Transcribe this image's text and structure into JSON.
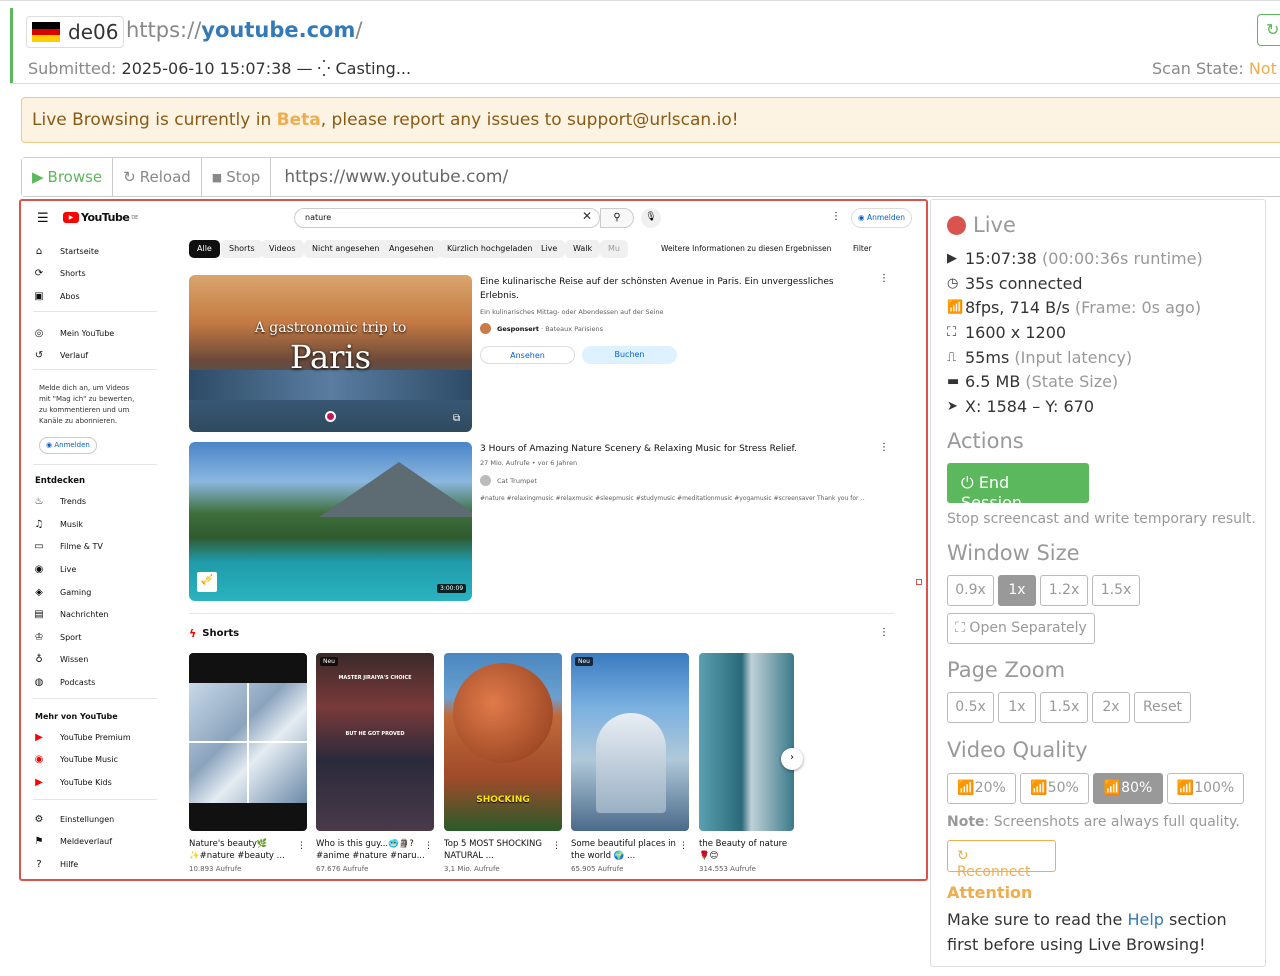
{
  "header": {
    "tag": "de06",
    "url_prefix": "https://",
    "url_domain": "youtube.com",
    "url_suffix": "/",
    "submitted_label": "Submitted:",
    "submitted_value": "2025-06-10 15:07:38",
    "status_sep": "—",
    "status": "Casting...",
    "scan_label": "Scan State:",
    "scan_value": "Not s"
  },
  "beta": {
    "pre": "Live Browsing is currently in ",
    "highlight": "Beta",
    "post": ", please report any issues to support@urlscan.io!"
  },
  "toolbar": {
    "browse": "Browse",
    "reload": "Reload",
    "stop": "Stop",
    "address": "https://www.youtube.com/"
  },
  "yt": {
    "logo": "YouTube",
    "logo_sup": "DE",
    "search_value": "nature",
    "signin": "Anmelden",
    "sidebar": {
      "home": "Startseite",
      "shorts": "Shorts",
      "subs": "Abos",
      "you": "Mein YouTube",
      "history": "Verlauf",
      "prompt": "Melde dich an, um Videos mit \"Mag ich\" zu bewerten, zu kommentieren und um Kanäle zu abonnieren.",
      "signin": "Anmelden",
      "explore_title": "Entdecken",
      "trends": "Trends",
      "music": "Musik",
      "movies": "Filme & TV",
      "live": "Live",
      "gaming": "Gaming",
      "news": "Nachrichten",
      "sport": "Sport",
      "learn": "Wissen",
      "podcasts": "Podcasts",
      "more_title": "Mehr von YouTube",
      "premium": "YouTube Premium",
      "ytmusic": "YouTube Music",
      "kids": "YouTube Kids",
      "settings": "Einstellungen",
      "report": "Meldeverlauf",
      "help": "Hilfe"
    },
    "chips": [
      "Alle",
      "Shorts",
      "Videos",
      "Nicht angesehen",
      "Angesehen",
      "Kürzlich hochgeladen",
      "Live",
      "Walk",
      "Mu"
    ],
    "more_info": "Weitere Informationen zu diesen Ergebnissen",
    "filter": "Filter",
    "ad": {
      "title": "Eine kulinarische Reise auf der schönsten Avenue in Paris. Ein unvergessliches Erlebnis.",
      "desc": "Ein kulinarisches Mittag- oder Abendessen auf der Seine",
      "sponsored": "Gesponsert",
      "sep": "·",
      "advertiser": "Bateaux Parisiens",
      "btn_view": "Ansehen",
      "btn_book": "Buchen",
      "thumb_line1": "A gastronomic trip to",
      "thumb_line2": "Paris"
    },
    "video": {
      "title": "3 Hours of Amazing Nature Scenery & Relaxing Music for Stress Relief.",
      "meta": "27 Mio. Aufrufe • vor 6 Jahren",
      "channel": "Cat Trumpet",
      "tags": "#nature #relaxingmusic #relaxmusic #sleepmusic #studymusic #meditationmusic #yogamusic #screensaver Thank you for ...",
      "duration": "3:00:09"
    },
    "shorts_title": "Shorts",
    "shorts": [
      {
        "title": "Nature's beauty🌿✨#nature #beauty ...",
        "views": "10.893 Aufrufe",
        "badge": ""
      },
      {
        "title": "Who is this guy...🥶🗿? #anime #nature #naru...",
        "views": "67.676 Aufrufe",
        "badge": "Neu"
      },
      {
        "title": "Top 5 MOST SHOCKING NATURAL ...",
        "views": "3,1 Mio. Aufrufe",
        "badge": ""
      },
      {
        "title": "Some beautiful places in the world 🌍 ...",
        "views": "65.905 Aufrufe",
        "badge": "Neu"
      },
      {
        "title": "the Beauty of nature🌹😊",
        "views": "314.553 Aufrufe",
        "badge": ""
      }
    ],
    "shorts_overlay": {
      "s2_top": "MASTER JIRAIYA'S CHOICE",
      "s2_mid": "BUT HE GOT PROVED",
      "s3": "SHOCKING"
    }
  },
  "panel": {
    "live": "Live",
    "time": "15:07:38",
    "runtime": "(00:00:36s runtime)",
    "connected": "35s connected",
    "fps": "8fps, 714 B/s",
    "frame": "(Frame: 0s ago)",
    "resolution": "1600 x 1200",
    "latency": "55ms",
    "latency_label": "(Input latency)",
    "state_size": "6.5 MB",
    "state_label": "(State Size)",
    "coords": "X: 1584 – Y: 670",
    "actions_title": "Actions",
    "end_session": "End Session",
    "end_desc": "Stop screencast and write temporary result.",
    "window_title": "Window Size",
    "window_sizes": [
      "0.9x",
      "1x",
      "1.2x",
      "1.5x"
    ],
    "open_separately": "Open Separately",
    "zoom_title": "Page Zoom",
    "zooms": [
      "0.5x",
      "1x",
      "1.5x",
      "2x",
      "Reset"
    ],
    "quality_title": "Video Quality",
    "qualities": [
      "20%",
      "50%",
      "80%",
      "100%"
    ],
    "note_label": "Note",
    "note": ": Screenshots are always full quality.",
    "reconnect": "Reconnect",
    "attention_title": "Attention",
    "attention_pre": "Make sure to read the ",
    "attention_link": "Help",
    "attention_post": " section first before using Live Browsing!"
  },
  "colors": {
    "green": "#5cb85c",
    "red": "#d9534f",
    "warn": "#f0ad4e",
    "link": "#337ab7"
  }
}
